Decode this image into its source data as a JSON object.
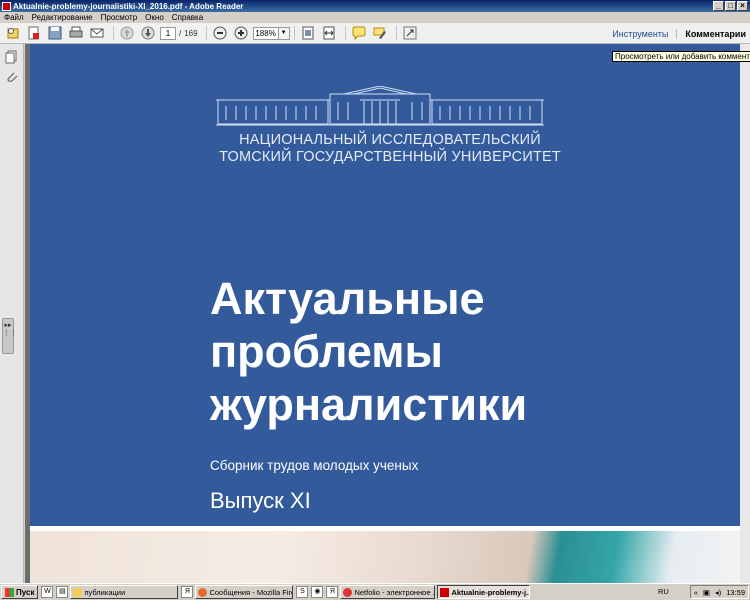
{
  "window": {
    "title": "Aktualnie-problemy-journalistiki-XI_2016.pdf - Adobe Reader"
  },
  "menu": [
    "Файл",
    "Редактирование",
    "Просмотр",
    "Окно",
    "Справка"
  ],
  "toolbar": {
    "page_current": "1",
    "page_sep": "/",
    "page_total": "169",
    "zoom": "188%",
    "tools_label": "Инструменты",
    "comments_label": "Комментарии"
  },
  "tooltip": "Просмотреть или добавить комментарии",
  "document": {
    "university_line1": "НАЦИОНАЛЬНЫЙ ИССЛЕДОВАТЕЛЬСКИЙ",
    "university_line2": "ТОМСКИЙ ГОСУДАРСТВЕННЫЙ УНИВЕРСИТЕТ",
    "title_line1": "Актуальные",
    "title_line2": "проблемы",
    "title_line3": "журналистики",
    "subtitle": "Сборник трудов молодых ученых",
    "issue": "Выпуск XI",
    "colors": {
      "cover_blue": "#335a9b",
      "text_light": "#e3ecf8"
    }
  },
  "taskbar": {
    "start_label": "Пуск",
    "tasks": [
      {
        "label": "публикации"
      },
      {
        "label": "Сообщения - Mozilla Fire..."
      },
      {
        "label": "Netfolio - электронное ..."
      },
      {
        "label": "Aktualnie-problemy-j..."
      }
    ],
    "lang": "RU",
    "clock": "13:59"
  }
}
